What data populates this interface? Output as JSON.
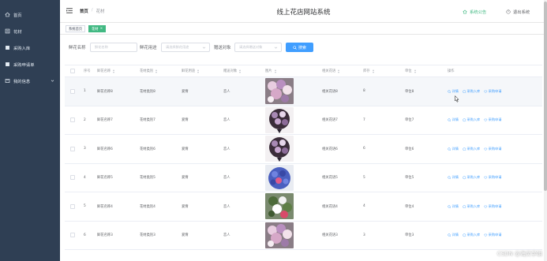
{
  "sidebar": {
    "items": [
      {
        "label": "首页",
        "icon": "home-icon"
      },
      {
        "label": "花材",
        "icon": "document-icon"
      },
      {
        "label": "采购入库",
        "icon": "document-icon"
      },
      {
        "label": "采购申请单",
        "icon": "document-icon"
      },
      {
        "label": "我的信息",
        "icon": "user-icon"
      }
    ],
    "bg_color": "#2f3f54"
  },
  "header": {
    "breadcrumb": [
      "首页",
      "花材"
    ],
    "site_title": "线上花店网站系统",
    "notice_label": "系统公告",
    "logout_label": "退出系统",
    "notice_color": "#42b983"
  },
  "tags": [
    {
      "label": "系统首页",
      "active": false
    },
    {
      "label": "花材",
      "active": true
    }
  ],
  "search": {
    "name_label": "鲜花名称",
    "name_placeholder": "鲜花名称",
    "use_label": "鲜花用途",
    "use_placeholder": "请选择鲜花用途",
    "target_label": "赠送对象",
    "target_placeholder": "请选择赠送对象",
    "button_label": "搜索",
    "accent_color": "#409eff"
  },
  "table": {
    "columns": [
      "序号",
      "鲜花名称",
      "花材类别",
      "鲜花用途",
      "赠送对象",
      "图片",
      "相关花语",
      "库存",
      "单位",
      "操作"
    ],
    "rows": [
      {
        "index": "1",
        "name": "鲜花名称8",
        "category": "花材类别8",
        "use": "爱情",
        "target": "恋人",
        "language": "相关花语8",
        "stock": "8",
        "unit": "单位8",
        "photo": "photo-pink"
      },
      {
        "index": "2",
        "name": "鲜花名称7",
        "category": "花材类别7",
        "use": "爱情",
        "target": "恋人",
        "language": "相关花语7",
        "stock": "7",
        "unit": "单位7",
        "photo": "photo-dark-bouquet"
      },
      {
        "index": "3",
        "name": "鲜花名称6",
        "category": "花材类别6",
        "use": "爱情",
        "target": "恋人",
        "language": "相关花语6",
        "stock": "6",
        "unit": "单位6",
        "photo": "photo-dark-bouquet"
      },
      {
        "index": "4",
        "name": "鲜花名称5",
        "category": "花材类别5",
        "use": "爱情",
        "target": "恋人",
        "language": "相关花语5",
        "stock": "5",
        "unit": "单位5",
        "photo": "photo-blue"
      },
      {
        "index": "5",
        "name": "鲜花名称4",
        "category": "花材类别4",
        "use": "爱情",
        "target": "恋人",
        "language": "相关花语4",
        "stock": "4",
        "unit": "单位4",
        "photo": "photo-green"
      },
      {
        "index": "6",
        "name": "鲜花名称3",
        "category": "花材类别3",
        "use": "爱情",
        "target": "恋人",
        "language": "相关花语3",
        "stock": "3",
        "unit": "单位3",
        "photo": "photo-pink"
      }
    ],
    "ops": {
      "detail": "详情",
      "stock_in": "采购入库",
      "apply": "采购申请"
    }
  },
  "watermark": "CSDN @海灵学姐"
}
